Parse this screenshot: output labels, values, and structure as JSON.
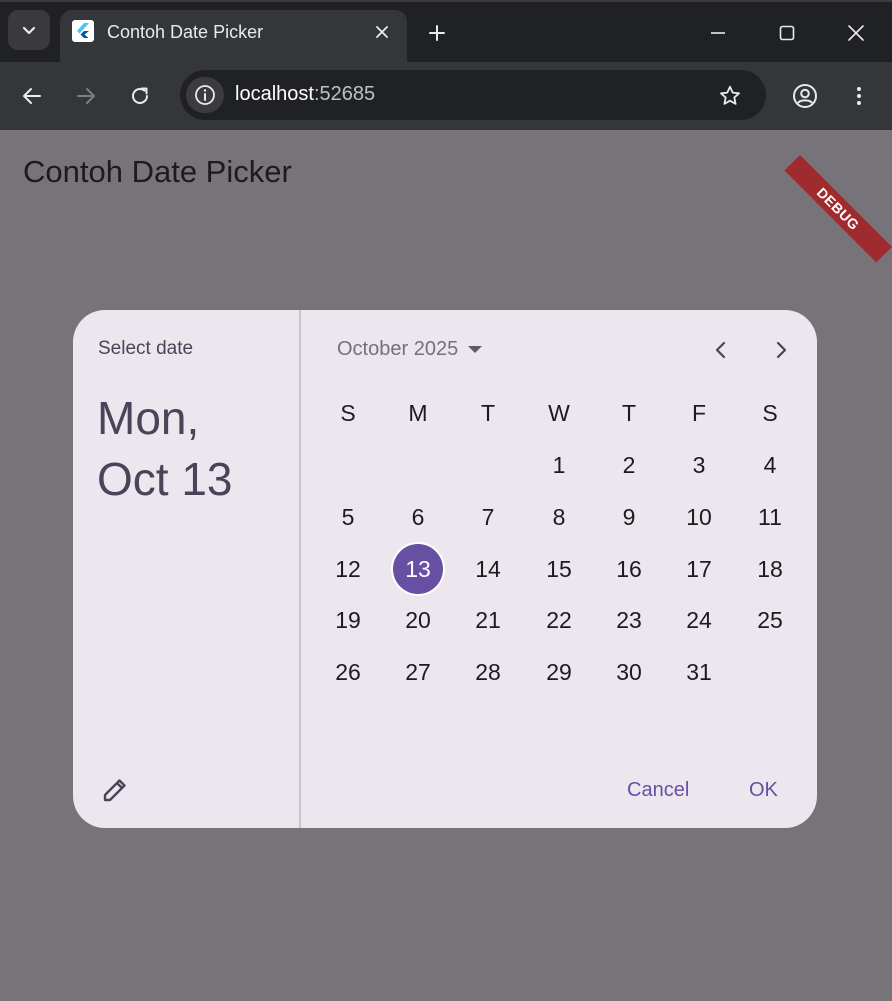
{
  "browser": {
    "tab_title": "Contoh Date Picker",
    "url_host": "localhost",
    "url_port": ":52685"
  },
  "app": {
    "title": "Contoh Date Picker",
    "debug_label": "DEBUG"
  },
  "dialog": {
    "help_text": "Select date",
    "headline_line1": "Mon,",
    "headline_line2": "Oct 13",
    "month_label": "October 2025",
    "weekdays": [
      "S",
      "M",
      "T",
      "W",
      "T",
      "F",
      "S"
    ],
    "weeks": [
      [
        "",
        "",
        "",
        "1",
        "2",
        "3",
        "4"
      ],
      [
        "5",
        "6",
        "7",
        "8",
        "9",
        "10",
        "11"
      ],
      [
        "12",
        "13",
        "14",
        "15",
        "16",
        "17",
        "18"
      ],
      [
        "19",
        "20",
        "21",
        "22",
        "23",
        "24",
        "25"
      ],
      [
        "26",
        "27",
        "28",
        "29",
        "30",
        "31",
        ""
      ]
    ],
    "selected_day": "13",
    "cancel_label": "Cancel",
    "ok_label": "OK"
  },
  "colors": {
    "accent": "#6750a4",
    "scrim": "#787378",
    "dialog_surface": "#ece6ef",
    "debug_banner": "#a02b2e"
  },
  "icons": {
    "tab_search": "chevron-down-icon",
    "favicon": "flutter-icon",
    "tab_close": "close-icon",
    "new_tab": "plus-icon",
    "minimize": "minimize-icon",
    "maximize": "maximize-icon",
    "close_window": "close-icon",
    "back": "arrow-left-icon",
    "forward": "arrow-right-icon",
    "reload": "reload-icon",
    "site_info": "info-icon",
    "bookmark": "star-icon",
    "profile": "account-icon",
    "menu": "more-vert-icon",
    "prev_month": "chevron-left-icon",
    "next_month": "chevron-right-icon",
    "edit": "pencil-icon"
  }
}
